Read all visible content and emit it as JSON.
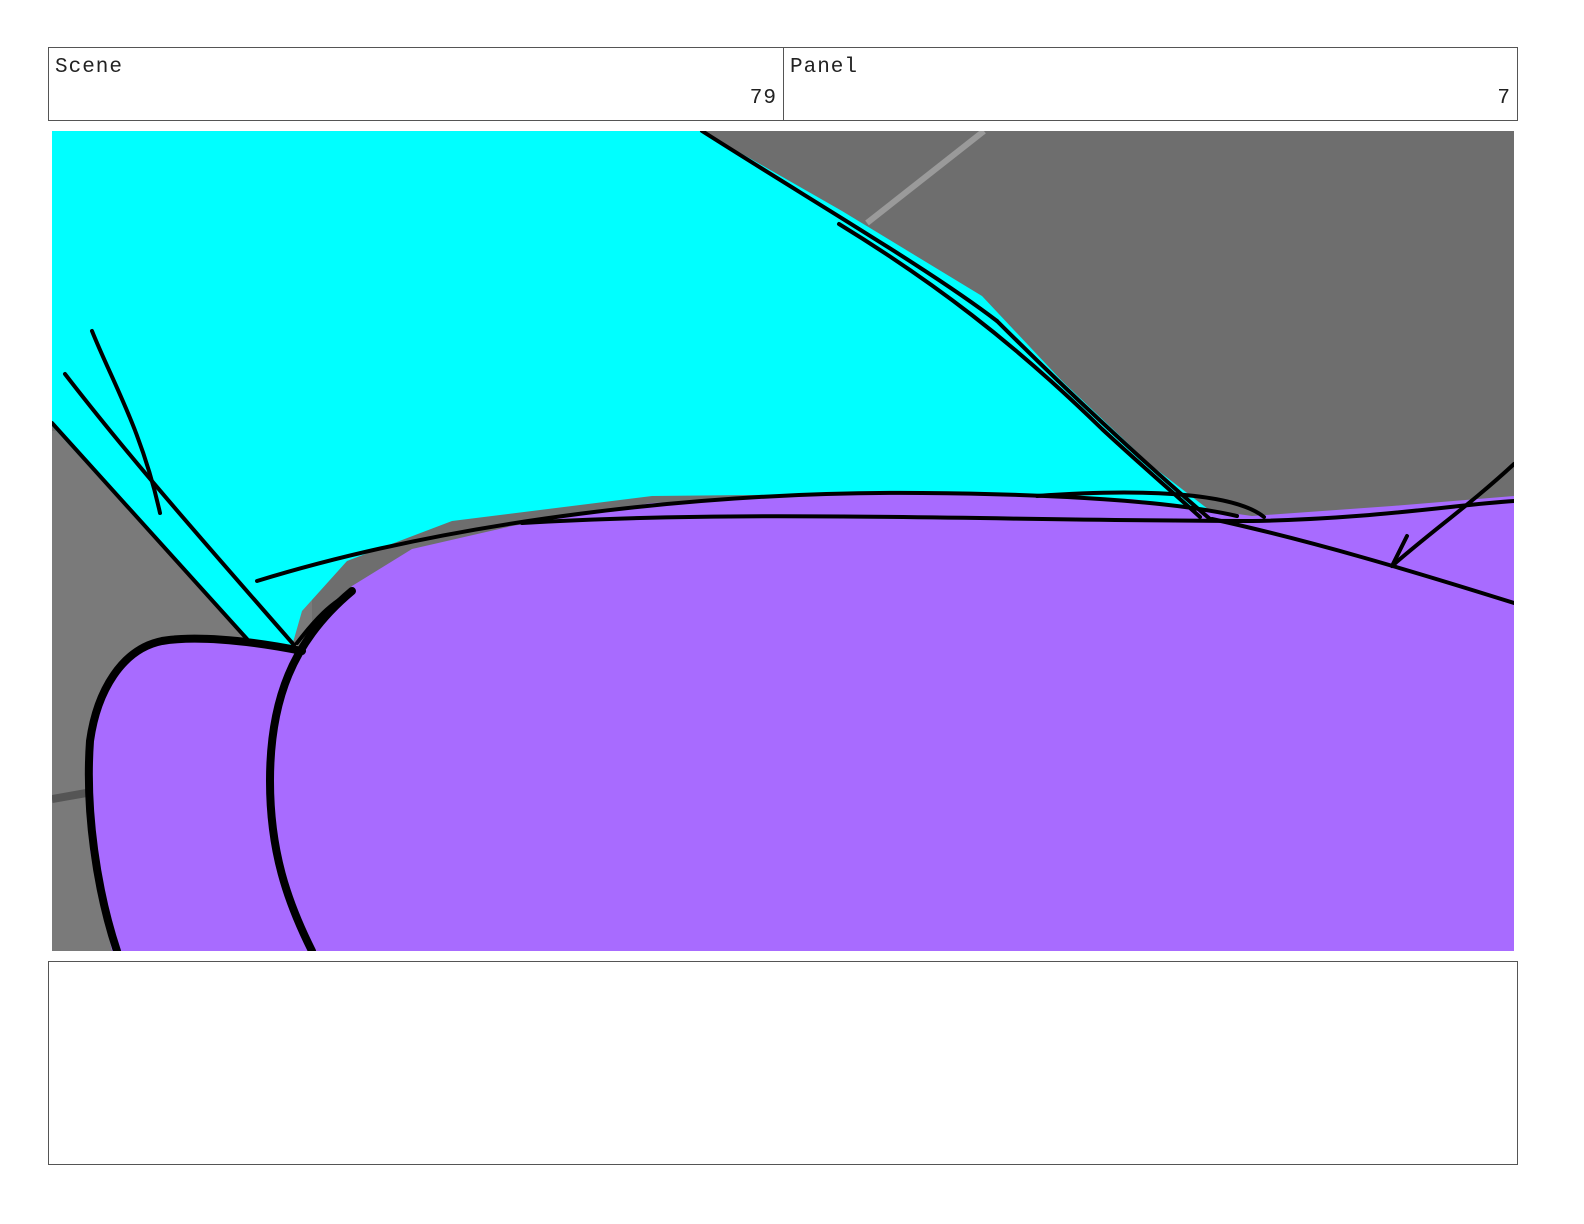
{
  "header": {
    "scene_label": "Scene",
    "scene_number": "79",
    "panel_label": "Panel",
    "panel_number": "7"
  },
  "notes": {
    "text": ""
  },
  "colors": {
    "background_gray": "#6e6e6e",
    "cyan_shape": "#00ffff",
    "purple_shape": "#a86bff",
    "ink": "#000000"
  }
}
